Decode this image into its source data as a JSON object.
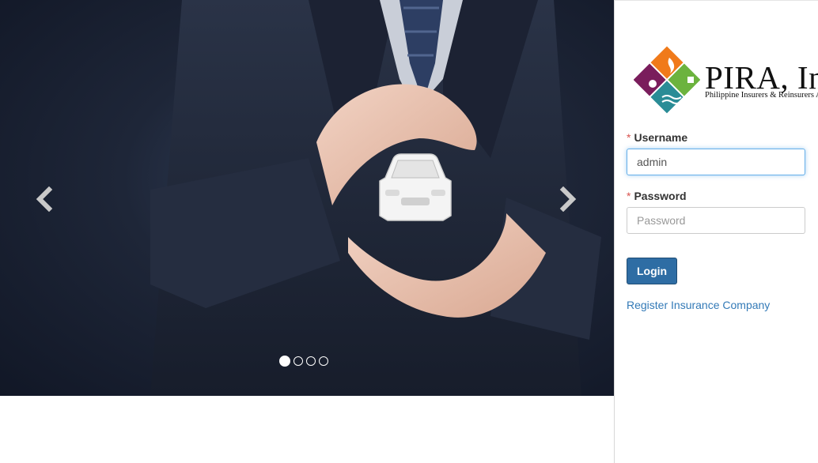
{
  "carousel": {
    "prev_icon": "chevron-left-icon",
    "next_icon": "chevron-right-icon",
    "slide_count": 4,
    "active_slide": 1
  },
  "logo": {
    "title": "PIRA, Inc.",
    "subtitle": "Philippine Insurers & Reinsurers Association"
  },
  "form": {
    "username_label": "Username",
    "username_value": "admin",
    "password_label": "Password",
    "password_placeholder": "Password",
    "required_mark": "*",
    "login_button": "Login",
    "register_link": "Register Insurance Company"
  },
  "colors": {
    "primary_button": "#2e6da4",
    "link": "#337ab7",
    "required": "#d9534f",
    "focus_border": "#66afe9"
  }
}
